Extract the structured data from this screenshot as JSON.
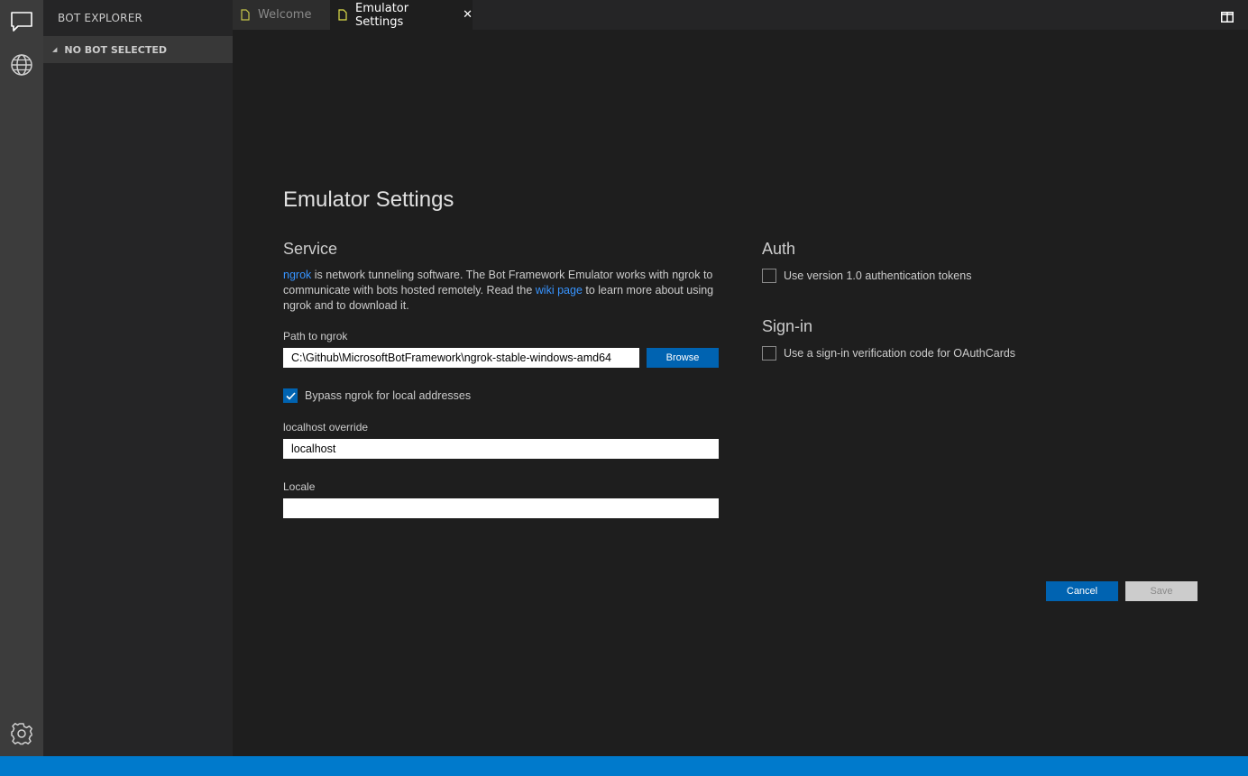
{
  "activity_bar": {
    "items": [
      {
        "name": "chat-icon"
      },
      {
        "name": "globe-icon"
      },
      {
        "name": "gear-icon"
      }
    ]
  },
  "sidebar": {
    "title": "BOT EXPLORER",
    "section": "NO BOT SELECTED"
  },
  "tabs": [
    {
      "label": "Welcome",
      "active": false
    },
    {
      "label": "Emulator Settings",
      "active": true,
      "close": "✕"
    }
  ],
  "settings": {
    "title": "Emulator Settings",
    "service": {
      "heading": "Service",
      "desc_link1": "ngrok",
      "desc_part1": " is network tunneling software. The Bot Framework Emulator works with ngrok to communicate with bots hosted remotely. Read the ",
      "desc_link2": "wiki page",
      "desc_part2": " to learn more about using ngrok and to download it.",
      "path_label": "Path to ngrok",
      "path_value": "C:\\Github\\MicrosoftBotFramework\\ngrok-stable-windows-amd64",
      "browse_label": "Browse",
      "bypass_label": "Bypass ngrok for local addresses",
      "bypass_checked": true,
      "localhost_label": "localhost override",
      "localhost_value": "localhost",
      "locale_label": "Locale",
      "locale_value": ""
    },
    "auth": {
      "heading": "Auth",
      "token_label": "Use version 1.0 authentication tokens",
      "token_checked": false
    },
    "signin": {
      "heading": "Sign-in",
      "code_label": "Use a sign-in verification code for OAuthCards",
      "code_checked": false
    },
    "cancel_label": "Cancel",
    "save_label": "Save"
  },
  "colors": {
    "accent": "#0063b1",
    "status_bar": "#007acc",
    "link": "#3794ff"
  }
}
